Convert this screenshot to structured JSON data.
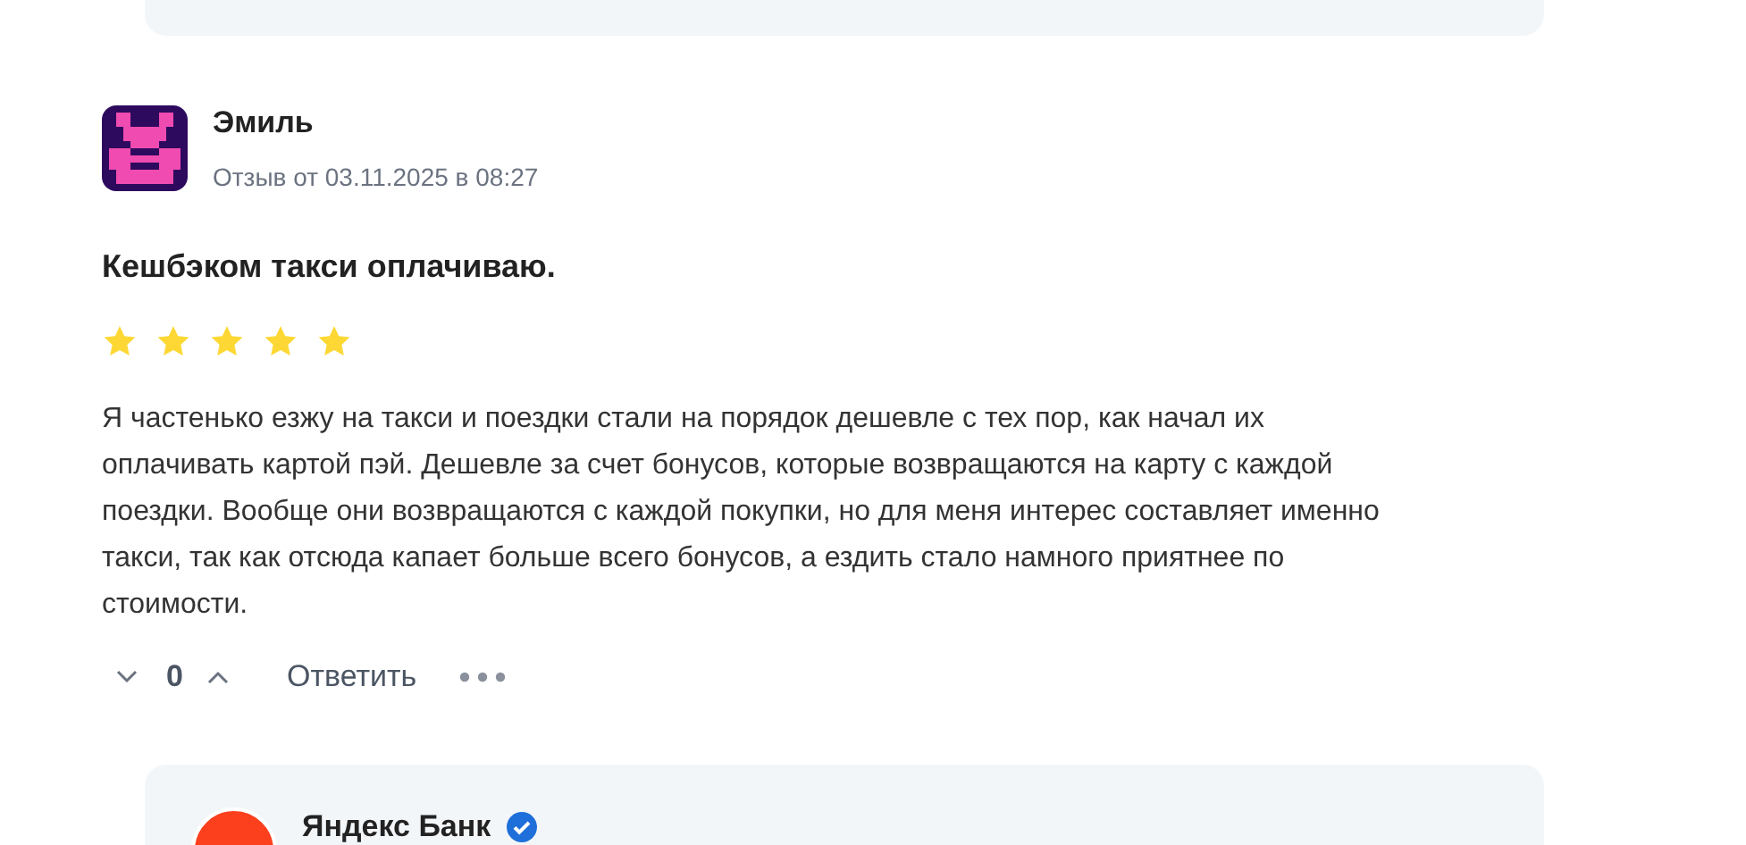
{
  "review": {
    "author": "Эмиль",
    "date": "Отзыв от 03.11.2025 в 08:27",
    "title": "Кешбэком такси оплачиваю.",
    "stars": 5,
    "text": "Я частенько езжу на такси и поездки стали на порядок дешевле с тех пор, как начал их оплачивать картой пэй. Дешевле за счет бонусов, которые возвращаются на карту с каждой поездки. Вообще они возвращаются с каждой покупки, но для меня интерес составляет именно такси, так как отсюда капает больше всего бонусов, а ездить стало намного приятнее по стоимости.",
    "votes": "0",
    "reply_label": "Ответить"
  },
  "bank_reply": {
    "author": "Яндекс Банк",
    "verified": true
  }
}
